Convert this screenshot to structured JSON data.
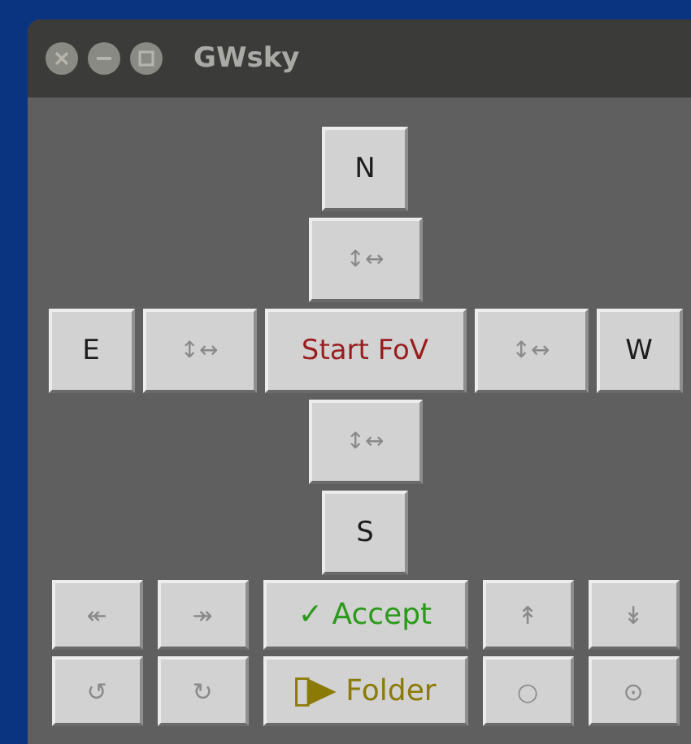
{
  "window": {
    "title": "GWsky"
  },
  "cross": [
    [
      {
        "label": "N",
        "kind": "compass"
      }
    ],
    [
      {
        "label": "↕↔",
        "kind": "adjust"
      }
    ],
    [
      {
        "label": "E",
        "kind": "compass"
      },
      {
        "label": "↕↔",
        "kind": "adjust"
      },
      {
        "label": "Start FoV",
        "kind": "start"
      },
      {
        "label": "↕↔",
        "kind": "adjust"
      },
      {
        "label": "W",
        "kind": "compass"
      }
    ],
    [
      {
        "label": "↕↔",
        "kind": "adjust"
      }
    ],
    [
      {
        "label": "S",
        "kind": "compass"
      }
    ]
  ],
  "grid": [
    [
      {
        "label": "↞",
        "kind": "small"
      },
      {
        "label": "↠",
        "kind": "small"
      },
      {
        "label": "✓ Accept",
        "kind": "accept"
      },
      {
        "label": "↟",
        "kind": "small"
      },
      {
        "label": "↡",
        "kind": "small"
      }
    ],
    [
      {
        "label": "↺",
        "kind": "small"
      },
      {
        "label": "↻",
        "kind": "small"
      },
      {
        "label": "Folder",
        "kind": "folder"
      },
      {
        "label": "○",
        "kind": "small"
      },
      {
        "label": "⊙",
        "kind": "small"
      }
    ]
  ]
}
